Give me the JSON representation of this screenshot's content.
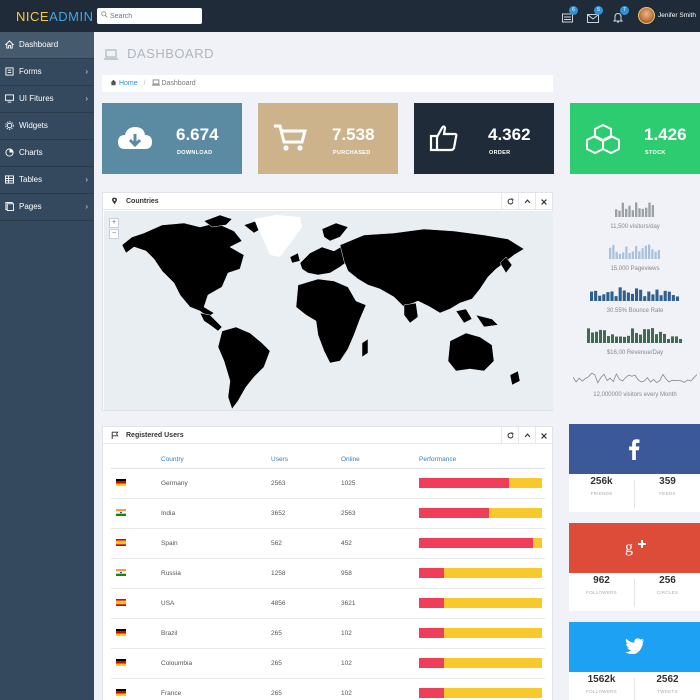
{
  "brand": {
    "nice": "NICE",
    "admin": "ADMIN"
  },
  "search": {
    "placeholder": "Search"
  },
  "topbar": {
    "tasks_badge": "6",
    "mail_badge": "5",
    "notifications_badge": "7",
    "user_name": "Jenifer Smith"
  },
  "sidebar": {
    "items": [
      {
        "label": "Dashboard",
        "icon": "home-icon",
        "active": true,
        "arrow": ""
      },
      {
        "label": "Forms",
        "icon": "document-icon",
        "active": false,
        "arrow": "›"
      },
      {
        "label": "UI Fitures",
        "icon": "desktop-icon",
        "active": false,
        "arrow": "›"
      },
      {
        "label": "Widgets",
        "icon": "cog-icon",
        "active": false,
        "arrow": ""
      },
      {
        "label": "Charts",
        "icon": "pie-chart-icon",
        "active": false,
        "arrow": ""
      },
      {
        "label": "Tables",
        "icon": "table-icon",
        "active": false,
        "arrow": "›"
      },
      {
        "label": "Pages",
        "icon": "pages-icon",
        "active": false,
        "arrow": "›"
      }
    ]
  },
  "page": {
    "title": "DASHBOARD"
  },
  "breadcrumb": {
    "home": "Home",
    "current": "Dashboard",
    "separator": "/"
  },
  "stats": [
    {
      "value": "6.674",
      "label": "DOWNLOAD",
      "color": "#5b8aa3",
      "icon": "cloud-download-icon"
    },
    {
      "value": "7.538",
      "label": "PURCHASED",
      "color": "#cdb38c",
      "icon": "cart-icon"
    },
    {
      "value": "4.362",
      "label": "ORDER",
      "color": "#1f2b38",
      "icon": "thumbs-up-icon"
    },
    {
      "value": "1.426",
      "label": "STOCK",
      "color": "#2ecc71",
      "icon": "cubes-icon"
    }
  ],
  "map_panel": {
    "title": "Countries",
    "zoom_in": "+",
    "zoom_out": "−"
  },
  "users_panel": {
    "title": "Registered Users",
    "columns": [
      "Country",
      "Users",
      "Online",
      "Performance"
    ],
    "rows": [
      {
        "country": "Germany",
        "users": "2563",
        "online": "1025",
        "performance": 0.73,
        "flag": "de"
      },
      {
        "country": "India",
        "users": "3652",
        "online": "2563",
        "performance": 0.57,
        "flag": "in"
      },
      {
        "country": "Spain",
        "users": "562",
        "online": "452",
        "performance": 0.93,
        "flag": "es"
      },
      {
        "country": "Russia",
        "users": "1258",
        "online": "958",
        "performance": 0.2,
        "flag": "in"
      },
      {
        "country": "USA",
        "users": "4856",
        "online": "3621",
        "performance": 0.2,
        "flag": "es"
      },
      {
        "country": "Brazil",
        "users": "265",
        "online": "102",
        "performance": 0.2,
        "flag": "de"
      },
      {
        "country": "Coloumbia",
        "users": "265",
        "online": "102",
        "performance": 0.2,
        "flag": "de"
      },
      {
        "country": "France",
        "users": "265",
        "online": "102",
        "performance": 0.2,
        "flag": "de"
      }
    ]
  },
  "stats_side": [
    {
      "label": "11,500 visitors/day",
      "color": "#9aa0a6"
    },
    {
      "label": "15,000 Pageviews",
      "color": "#a9c2dc"
    },
    {
      "label": "30.55% Bounce Rate",
      "color": "#2e5f8e"
    },
    {
      "label": "$16,00 Revenue/Day",
      "color": "#3f6b50"
    },
    {
      "label": "12,000000 visitors every Month",
      "color": "#888888"
    }
  ],
  "social": [
    {
      "network": "facebook",
      "icon": "facebook-icon",
      "color": "#3b5998",
      "a_value": "256k",
      "a_label": "FRIENDS",
      "b_value": "359",
      "b_label": "FEEDS"
    },
    {
      "network": "google-plus",
      "icon": "google-plus-icon",
      "color": "#dd4b39",
      "a_value": "962",
      "a_label": "FOLLOWERS",
      "b_value": "256",
      "b_label": "CIRCLES"
    },
    {
      "network": "twitter",
      "icon": "twitter-icon",
      "color": "#1da1f2",
      "a_value": "1562k",
      "a_label": "FOLLOWERS",
      "b_value": "2562",
      "b_label": "TWEETS"
    }
  ]
}
